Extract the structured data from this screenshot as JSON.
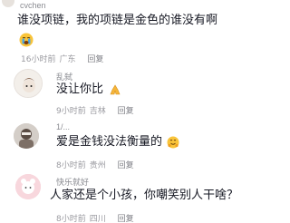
{
  "comments": [
    {
      "username": "cvchen",
      "text": "谁没项链，我的项链是金色的谁没有啊",
      "emoji": "crying-face",
      "time": "16小时前",
      "location": "广东",
      "reply_label": "回复"
    },
    {
      "username": "乱弑",
      "text": "没让你比",
      "emoji": "praying-hands",
      "time": "9小时前",
      "location": "吉林",
      "reply_label": "回复"
    },
    {
      "username": "1/...",
      "text": "爱是金钱没法衡量的",
      "emoji": "hugging-face",
      "time": "8小时前",
      "location": "贵州",
      "reply_label": "回复"
    },
    {
      "username": "快乐就好",
      "text": "人家还是个小孩，你嘲笑别人干啥？",
      "time": "8小时前",
      "location": "四川",
      "reply_label": "回复"
    }
  ]
}
